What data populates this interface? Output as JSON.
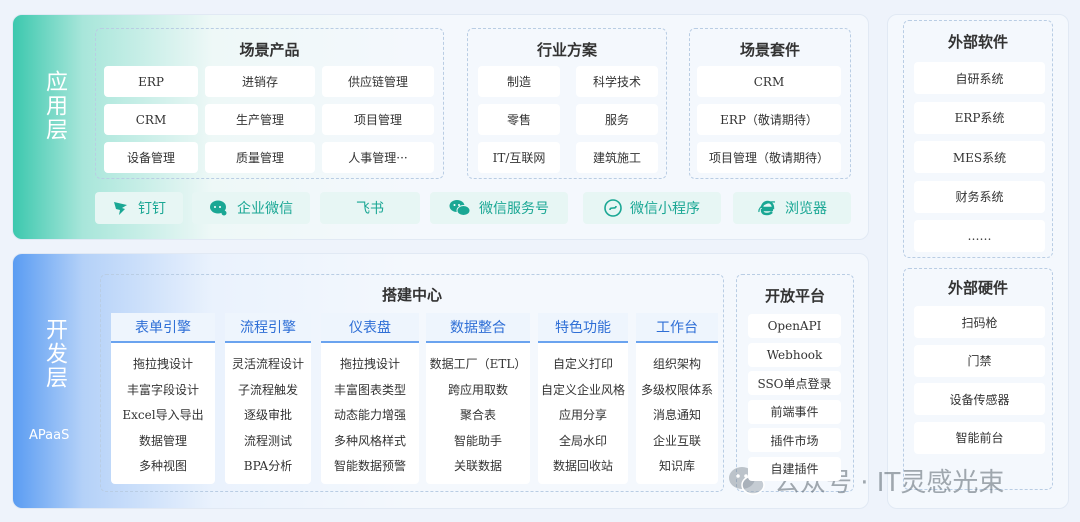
{
  "app_layer": {
    "label": "应用层",
    "scene_products": {
      "title": "场景产品",
      "items": [
        "ERP",
        "进销存",
        "供应链管理",
        "CRM",
        "生产管理",
        "项目管理",
        "设备管理",
        "质量管理",
        "人事管理···"
      ]
    },
    "industry": {
      "title": "行业方案",
      "items": [
        "制造",
        "科学技术",
        "零售",
        "服务",
        "IT/互联网",
        "建筑施工"
      ]
    },
    "suites": {
      "title": "场景套件",
      "items": [
        "CRM",
        "ERP（敬请期待）",
        "项目管理（敬请期待）"
      ]
    },
    "channels": [
      "钉钉",
      "企业微信",
      "飞书",
      "微信服务号",
      "微信小程序",
      "浏览器"
    ]
  },
  "dev_layer": {
    "label": "开发层",
    "sublabel": "APaaS",
    "build_center": {
      "title": "搭建中心",
      "columns": [
        {
          "title": "表单引擎",
          "items": [
            "拖拉拽设计",
            "丰富字段设计",
            "Excel导入导出",
            "数据管理",
            "多种视图"
          ]
        },
        {
          "title": "流程引擎",
          "items": [
            "灵活流程设计",
            "子流程触发",
            "逐级审批",
            "流程测试",
            "BPA分析"
          ]
        },
        {
          "title": "仪表盘",
          "items": [
            "拖拉拽设计",
            "丰富图表类型",
            "动态能力增强",
            "多种风格样式",
            "智能数据预警"
          ]
        },
        {
          "title": "数据整合",
          "items": [
            "数据工厂（ETL）",
            "跨应用取数",
            "聚合表",
            "智能助手",
            "关联数据"
          ]
        },
        {
          "title": "特色功能",
          "items": [
            "自定义打印",
            "自定义企业风格",
            "应用分享",
            "全局水印",
            "数据回收站"
          ]
        },
        {
          "title": "工作台",
          "items": [
            "组织架构",
            "多级权限体系",
            "消息通知",
            "企业互联",
            "知识库"
          ]
        }
      ]
    },
    "open_platform": {
      "title": "开放平台",
      "items": [
        "OpenAPI",
        "Webhook",
        "SSO单点登录",
        "前端事件",
        "插件市场",
        "自建插件"
      ]
    }
  },
  "external_software": {
    "title": "外部软件",
    "items": [
      "自研系统",
      "ERP系统",
      "MES系统",
      "财务系统",
      "……"
    ]
  },
  "external_hardware": {
    "title": "外部硬件",
    "items": [
      "扫码枪",
      "门禁",
      "设备传感器",
      "智能前台"
    ]
  },
  "watermark": {
    "text": "公众号 · IT灵感光束"
  },
  "colors": {
    "app_accent": "#2ec4a9",
    "dev_accent": "#4a8ff0",
    "channel_text": "#1aa794",
    "column_title": "#2f6fd6"
  }
}
